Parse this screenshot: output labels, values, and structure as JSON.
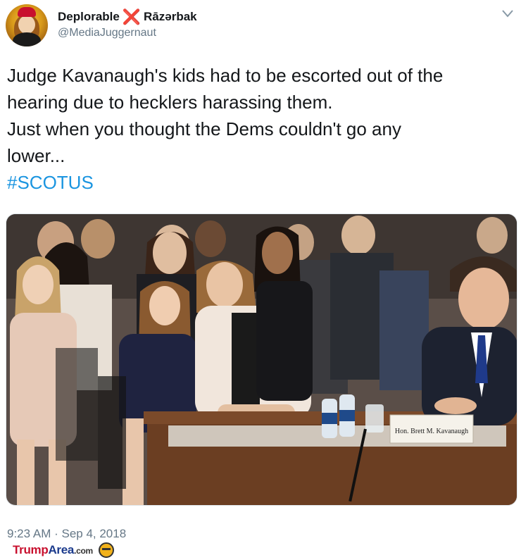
{
  "tweet": {
    "display_name": "Deplorable",
    "display_name_suffix": "Rāzərbak",
    "x_emoji": "❌",
    "handle": "@MediaJuggernaut",
    "text_lines": [
      "Judge Kavanaugh's kids had to be escorted out of the",
      "hearing due to hecklers harassing them.",
      "Just when you thought the Dems couldn't go any",
      "lower..."
    ],
    "hashtag": "#SCOTUS",
    "timestamp": "9:23 AM · Sep 4, 2018",
    "menu_icon": "chevron-down-icon"
  },
  "photo": {
    "nameplate": "Hon. Brett M. Kavanaugh"
  },
  "watermark": {
    "brand_trump": "Trump",
    "brand_area": "Area",
    "brand_domain": ".com"
  },
  "colors": {
    "link": "#1b95e0",
    "secondary_text": "#657786",
    "brand_red": "#c8102e",
    "brand_blue": "#1b3a8c"
  }
}
